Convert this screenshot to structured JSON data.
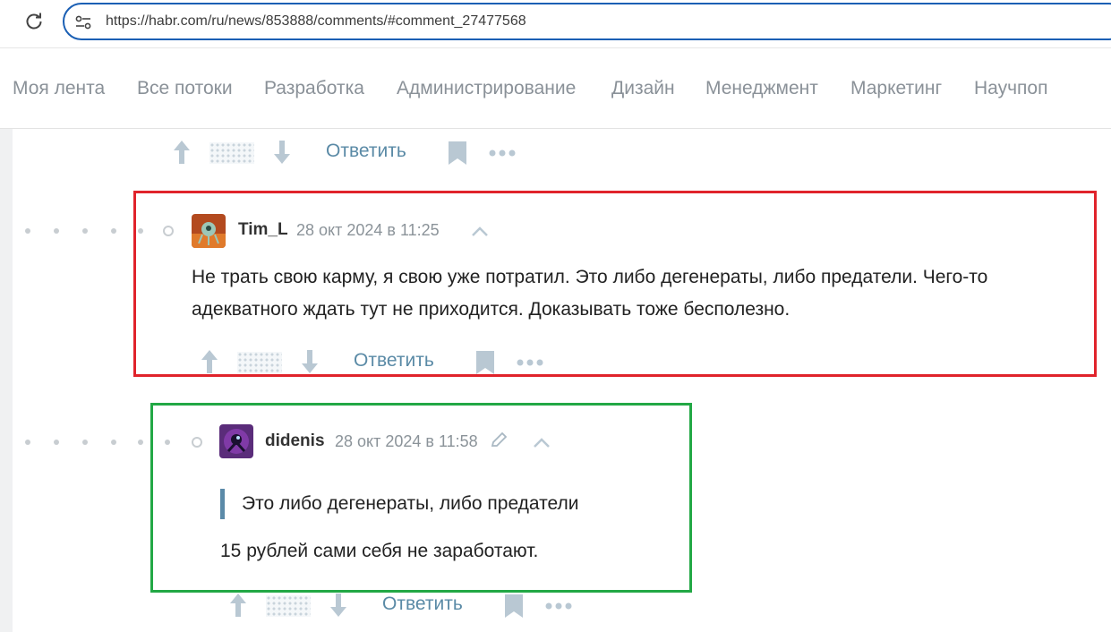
{
  "browser": {
    "url": "https://habr.com/ru/news/853888/comments/#comment_27477568"
  },
  "nav": {
    "items": [
      "Моя лента",
      "Все потоки",
      "Разработка",
      "Администрирование",
      "Дизайн",
      "Менеджмент",
      "Маркетинг",
      "Научпоп"
    ]
  },
  "controls": {
    "reply_label": "Ответить"
  },
  "comments": [
    {
      "author": "Tim_L",
      "date": "28 окт 2024 в 11:25",
      "text_line1": "Не трать свою карму, я свою уже потратил. Это либо дегенераты, либо предатели. Чего-то",
      "text_line2": "адекватного ждать тут не приходится. Доказывать тоже бесполезно.",
      "highlight_color": "#e0232b"
    },
    {
      "author": "didenis",
      "date": "28 окт 2024 в 11:58",
      "edited": true,
      "quote": "Это либо дегенераты, либо предатели",
      "text": "15 рублей сами себя не заработают.",
      "highlight_color": "#22a845"
    }
  ],
  "colors": {
    "link": "#5a8aa6",
    "nav_text": "#8a9198",
    "url_border": "#1a5fb4",
    "quote_bar": "#5b8aa8"
  }
}
